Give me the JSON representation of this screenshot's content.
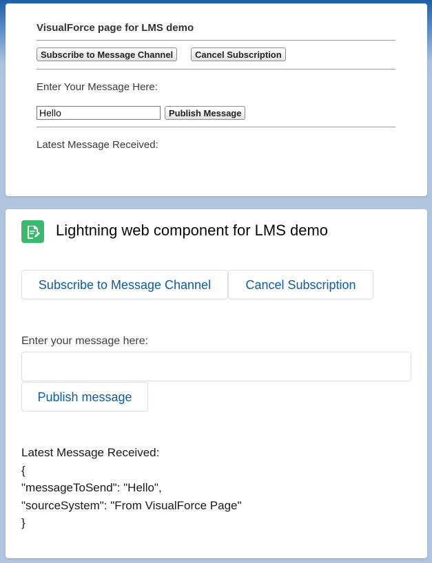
{
  "vf": {
    "title": "VisualForce page for LMS demo",
    "subscribe_label": "Subscribe to Message Channel",
    "cancel_label": "Cancel Subscription",
    "enter_label": "Enter Your Message Here:",
    "input_value": "Hello",
    "publish_label": "Publish Message",
    "latest_label": "Latest Message Received:"
  },
  "lwc": {
    "icon": "document-edit-icon",
    "icon_color": "#3bba6f",
    "title": "Lightning web component for LMS demo",
    "subscribe_label": "Subscribe to Message Channel",
    "cancel_label": "Cancel Subscription",
    "enter_label": "Enter your message here:",
    "input_value": "",
    "publish_label": "Publish message",
    "latest_label": "Latest Message Received:",
    "message_lines": [
      "{",
      "\"messageToSend\": \"Hello\",",
      "\"sourceSystem\": \"From VisualForce Page\"",
      "}"
    ]
  },
  "colors": {
    "brand_link": "#0b5cab",
    "background": "#b0c4df"
  }
}
